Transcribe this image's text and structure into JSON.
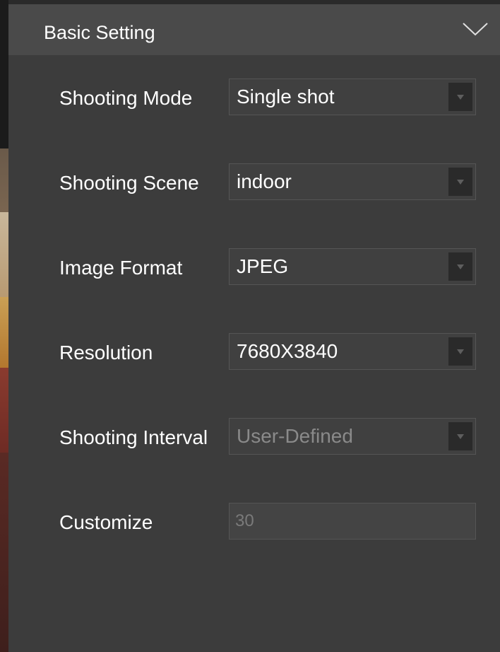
{
  "panel": {
    "title": "Basic Setting",
    "collapse_icon": "chevron-down-icon"
  },
  "settings": {
    "shooting_mode": {
      "label": "Shooting Mode",
      "value": "Single shot"
    },
    "shooting_scene": {
      "label": "Shooting Scene",
      "value": "indoor"
    },
    "image_format": {
      "label": "Image Format",
      "value": "JPEG"
    },
    "resolution": {
      "label": "Resolution",
      "value": "7680X3840"
    },
    "shooting_interval": {
      "label": "Shooting Interval",
      "value": "User-Defined",
      "disabled": true
    },
    "customize": {
      "label": "Customize",
      "value": "30",
      "disabled": true
    }
  },
  "colors": {
    "panel_bg": "#3c3c3c",
    "header_bg": "#4a4a4a",
    "text": "#ffffff",
    "disabled_text": "#8a8a8a"
  }
}
